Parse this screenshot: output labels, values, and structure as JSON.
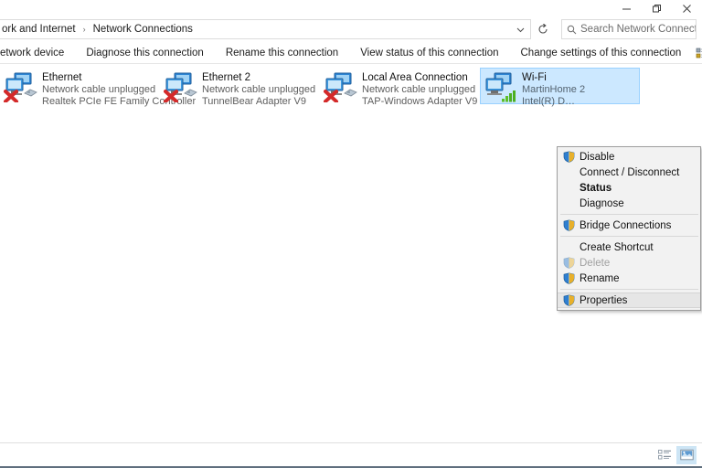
{
  "window": {
    "title": "Network Connections",
    "controls": [
      {
        "name": "minimize",
        "glyph": "─"
      },
      {
        "name": "maximize",
        "glyph": "❐"
      },
      {
        "name": "close",
        "glyph": "✕"
      }
    ]
  },
  "address": {
    "breadcrumb": [
      "ork and Internet",
      "Network Connections"
    ],
    "separator": "›",
    "dropdown_glyph": "∨",
    "refresh_glyph": "↻"
  },
  "search": {
    "placeholder": "Search Network Connections",
    "icon": "search-icon"
  },
  "commandbar": {
    "items": [
      "etwork device",
      "Diagnose this connection",
      "Rename this connection",
      "View status of this connection",
      "Change settings of this connection"
    ],
    "right_icons": [
      {
        "name": "organize-view-icon"
      },
      {
        "name": "chevron-down-icon",
        "glyph": "▼"
      },
      {
        "name": "preview-pane-icon"
      },
      {
        "name": "help-icon",
        "glyph": "?"
      }
    ]
  },
  "connections": [
    {
      "name": "Ethernet",
      "status": "Network cable unplugged",
      "adapter": "Realtek PCIe FE Family Controller",
      "selected": false,
      "state": "unplugged",
      "icon": "network-adapter-icon"
    },
    {
      "name": "Ethernet 2",
      "status": "Network cable unplugged",
      "adapter": "TunnelBear Adapter V9",
      "selected": false,
      "state": "unplugged",
      "icon": "network-adapter-icon"
    },
    {
      "name": "Local Area Connection",
      "status": "Network cable unplugged",
      "adapter": "TAP-Windows Adapter V9",
      "selected": false,
      "state": "unplugged",
      "icon": "network-adapter-icon"
    },
    {
      "name": "Wi-Fi",
      "status": "MartinHome 2",
      "adapter": "Intel(R) D…",
      "selected": true,
      "state": "connected",
      "icon": "wifi-adapter-icon"
    }
  ],
  "context_menu": {
    "items": [
      {
        "label": "Disable",
        "shield": true,
        "bold": false,
        "disabled": false,
        "highlighted": false
      },
      {
        "label": "Connect / Disconnect",
        "shield": false,
        "bold": false,
        "disabled": false,
        "highlighted": false
      },
      {
        "label": "Status",
        "shield": false,
        "bold": true,
        "disabled": false,
        "highlighted": false
      },
      {
        "label": "Diagnose",
        "shield": false,
        "bold": false,
        "disabled": false,
        "highlighted": false
      },
      {
        "separator": true
      },
      {
        "label": "Bridge Connections",
        "shield": true,
        "bold": false,
        "disabled": false,
        "highlighted": false
      },
      {
        "separator": true
      },
      {
        "label": "Create Shortcut",
        "shield": false,
        "bold": false,
        "disabled": false,
        "highlighted": false
      },
      {
        "label": "Delete",
        "shield": true,
        "bold": false,
        "disabled": true,
        "highlighted": false
      },
      {
        "label": "Rename",
        "shield": true,
        "bold": false,
        "disabled": false,
        "highlighted": false
      },
      {
        "separator": true
      },
      {
        "label": "Properties",
        "shield": true,
        "bold": false,
        "disabled": false,
        "highlighted": true
      }
    ]
  },
  "statusbar": {
    "view_buttons": [
      {
        "name": "details-view-button",
        "active": false
      },
      {
        "name": "large-icons-view-button",
        "active": true
      }
    ]
  },
  "colors": {
    "selection": "#cce8ff",
    "selection_border": "#99d1ff",
    "menu_bg": "#f2f2f2",
    "menu_border": "#9e9e9e",
    "menu_highlight": "#e6e6e6",
    "help_blue": "#1a72c8",
    "error_red": "#d42a2a",
    "signal_green": "#4caf20",
    "bottom_edge": "#5f6f7e"
  }
}
